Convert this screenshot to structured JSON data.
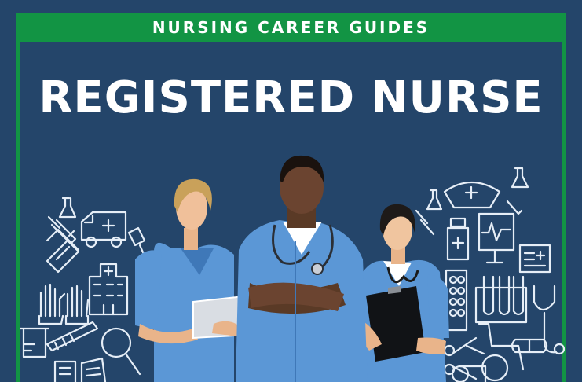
{
  "banner": {
    "text": "NURSING CAREER GUIDES"
  },
  "headline": {
    "text": "REGISTERED NURSE"
  },
  "colors": {
    "background": "#24456a",
    "accent_green": "#129444",
    "text": "#ffffff",
    "scrubs": "#5b97d6",
    "scrubs_dark": "#3f78b8",
    "icon_line": "#e6eef7"
  },
  "illustration": {
    "icons_left": [
      "flask-icon",
      "ambulance-icon",
      "bandage-icon",
      "hospital-building-icon",
      "gloves-icon",
      "thermometer-icon",
      "beaker-icon",
      "stethoscope-icon",
      "magnifier-icon",
      "microscope-icon"
    ],
    "icons_right": [
      "nurse-cap-icon",
      "flask-icon",
      "pill-bottle-icon",
      "heart-monitor-icon",
      "id-card-icon",
      "pill-blister-icon",
      "test-tubes-icon",
      "stethoscope-icon",
      "wheelchair-icon",
      "syringe-icon",
      "bandage-roll-icon"
    ],
    "people": [
      "nurse-with-tablet",
      "nurse-arms-crossed",
      "nurse-with-clipboard"
    ]
  }
}
